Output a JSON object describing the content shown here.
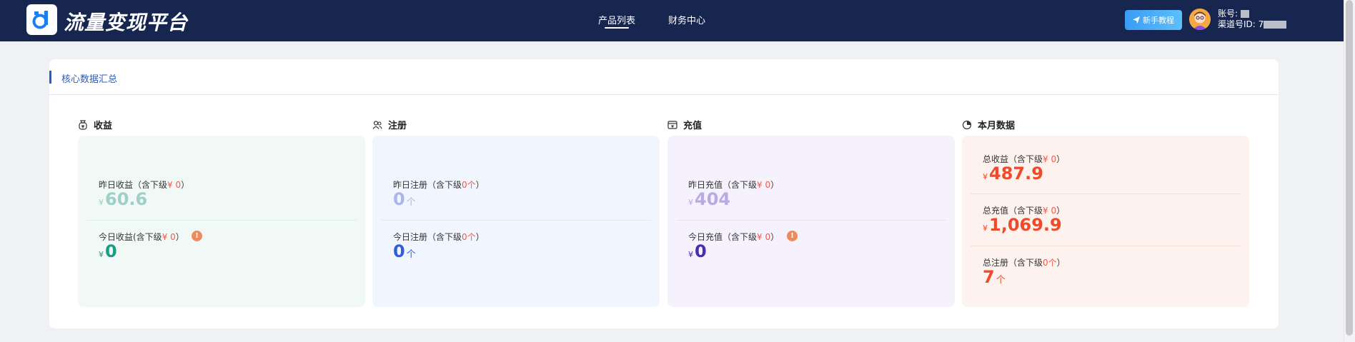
{
  "header": {
    "logo_text": "流量变现平台",
    "nav": [
      "产品列表",
      "财务中心"
    ],
    "guide_button": "新手教程",
    "account_label": "账号:",
    "channel_label": "渠道号ID:",
    "channel_value_prefix": "7"
  },
  "panel": {
    "title": "核心数据汇总"
  },
  "sections": {
    "income": {
      "title": "收益",
      "yesterday_label": "昨日收益（含下级",
      "yesterday_sub": "¥ 0",
      "yesterday_close": "）",
      "yesterday_currency": "¥",
      "yesterday_value": "60.6",
      "today_label": "今日收益(含下级",
      "today_sub": "¥ 0",
      "today_close": "）",
      "today_currency": "¥",
      "today_value": "0",
      "color": "#1c9c86",
      "faded_color": "#9fcfc6",
      "bg": "#f1f9f7"
    },
    "register": {
      "title": "注册",
      "yesterday_label": "昨日注册（含下级",
      "yesterday_sub": "0个",
      "yesterday_close": "）",
      "yesterday_value": "0",
      "yesterday_unit": "个",
      "today_label": "今日注册（含下级",
      "today_sub": "0个",
      "today_close": "）",
      "today_value": "0",
      "today_unit": "个",
      "color": "#2f5fe0",
      "faded_color": "#a9b8e8",
      "bg": "#f1f5fe"
    },
    "recharge": {
      "title": "充值",
      "yesterday_label": "昨日充值（含下级",
      "yesterday_sub": "¥ 0",
      "yesterday_close": "）",
      "yesterday_currency": "¥",
      "yesterday_value": "404",
      "today_label": "今日充值（含下级",
      "today_sub": "¥ 0",
      "today_close": "）",
      "today_currency": "¥",
      "today_value": "0",
      "color": "#4a2bb5",
      "faded_color": "#b6abe2",
      "bg": "#f5f2fd"
    },
    "month": {
      "title": "本月数据",
      "total_income_label": "总收益（含下级",
      "total_income_sub": "¥ 0",
      "total_income_close": "）",
      "total_income_currency": "¥",
      "total_income_value": "487.9",
      "total_recharge_label": "总充值（含下级",
      "total_recharge_sub": "¥ 0",
      "total_recharge_close": "）",
      "total_recharge_currency": "¥",
      "total_recharge_value": "1,069.9",
      "total_register_label": "总注册（含下级",
      "total_register_sub": "0个",
      "total_register_close": "）",
      "total_register_value": "7",
      "total_register_unit": "个",
      "color": "#ee4b2b",
      "bg": "#fdf2ee"
    }
  },
  "info_icon": "!"
}
